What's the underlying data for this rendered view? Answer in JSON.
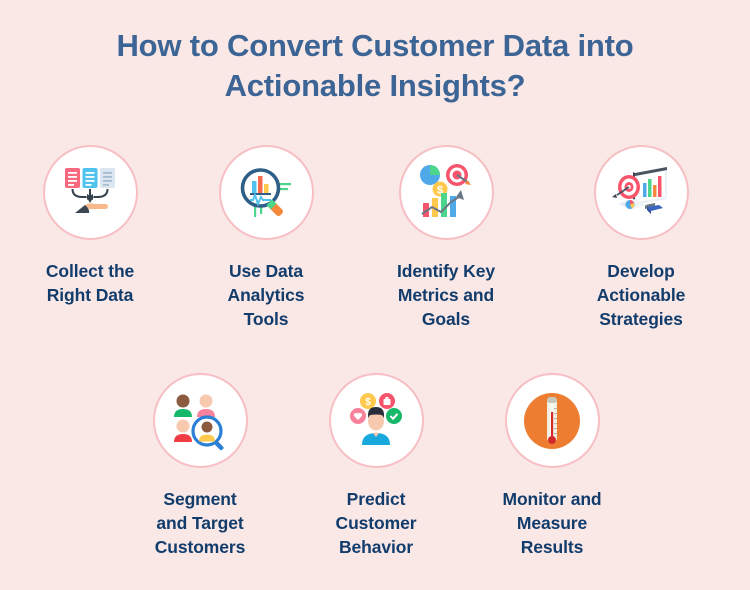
{
  "theme": {
    "background": "#FAE8E7",
    "title_color": "#3C6595",
    "label_color": "#123C6B",
    "circle_fill": "#FFFFFF",
    "circle_border": "#F7BFC4"
  },
  "header": {
    "title_line_1": "How to Convert Customer Data into",
    "title_line_2": "Actionable Insights?"
  },
  "steps": [
    {
      "id": "collect-the-right-data",
      "label": "Collect the\nRight Data",
      "icon": "documents-to-hand-icon"
    },
    {
      "id": "use-data-analytics-tools",
      "label": "Use Data\nAnalytics\nTools",
      "icon": "magnifier-bar-chart-icon"
    },
    {
      "id": "identify-key-metrics-and-goals",
      "label": "Identify Key\nMetrics and\nGoals",
      "icon": "pie-target-bar-chart-icon"
    },
    {
      "id": "develop-actionable-strategies",
      "label": "Develop\nActionable\nStrategies",
      "icon": "monitor-target-strategy-icon"
    },
    {
      "id": "segment-and-target-customers",
      "label": "Segment\nand Target\nCustomers",
      "icon": "people-magnifier-icon"
    },
    {
      "id": "predict-customer-behavior",
      "label": "Predict\nCustomer\nBehavior",
      "icon": "person-behavior-bubbles-icon"
    },
    {
      "id": "monitor-and-measure-results",
      "label": "Monitor and\nMeasure\nResults",
      "icon": "thermometer-icon"
    }
  ]
}
